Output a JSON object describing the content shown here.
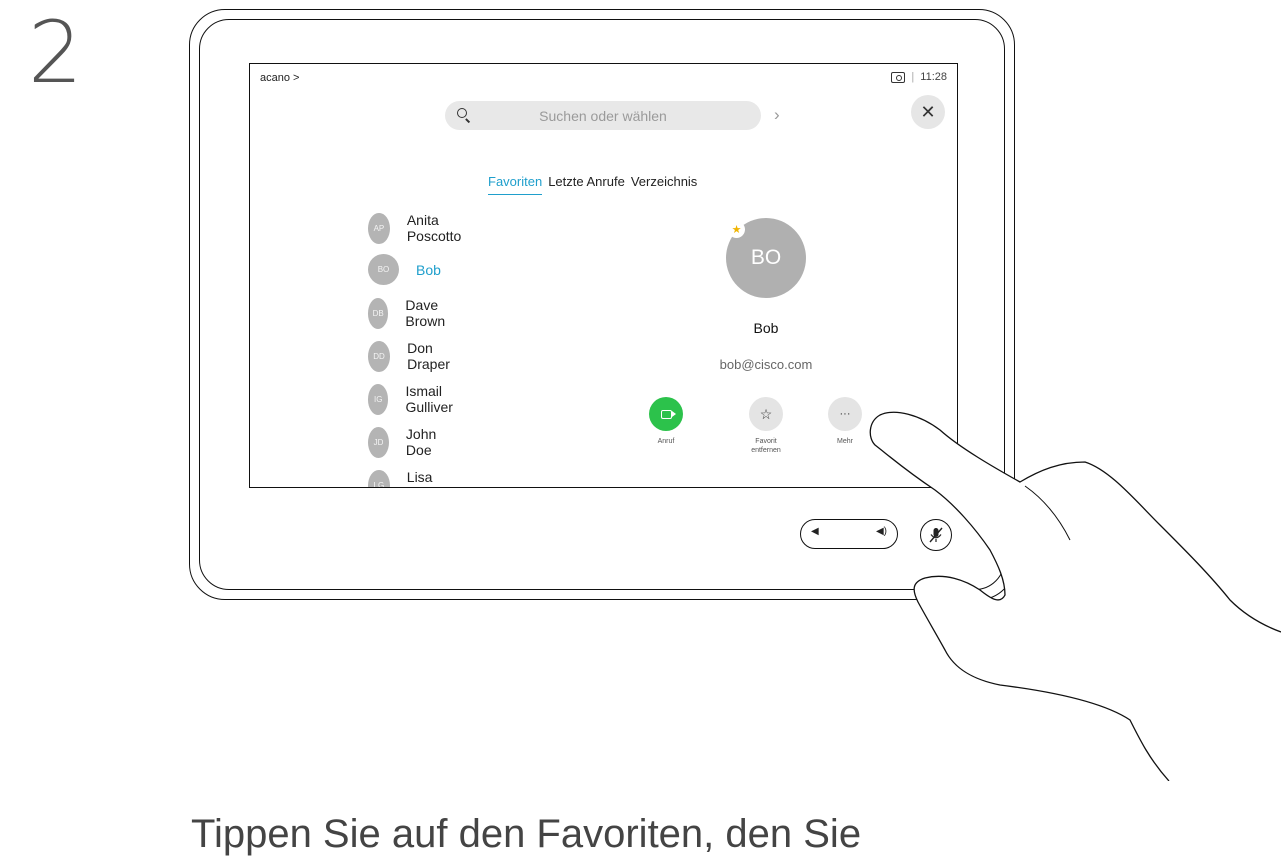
{
  "step_number": "2",
  "status_bar": {
    "brand": "acano",
    "time": "11:28"
  },
  "search": {
    "placeholder": "Suchen oder wählen"
  },
  "tabs": [
    {
      "label": "Favoriten",
      "active": true
    },
    {
      "label": "Letzte Anrufe",
      "active": false
    },
    {
      "label": "Verzeichnis",
      "active": false
    }
  ],
  "contacts": [
    {
      "initials": "AP",
      "name": "Anita Poscotto"
    },
    {
      "initials": "BO",
      "name": "Bob",
      "selected": true
    },
    {
      "initials": "DB",
      "name": "Dave Brown"
    },
    {
      "initials": "DD",
      "name": "Don Draper"
    },
    {
      "initials": "IG",
      "name": "Ismail Gulliver"
    },
    {
      "initials": "JD",
      "name": "John Doe"
    },
    {
      "initials": "LG",
      "name": "Lisa Green"
    }
  ],
  "detail": {
    "initials": "BO",
    "name": "Bob",
    "email": "bob@cisco.com",
    "actions": {
      "call": "Anruf",
      "favorite": "Favorit entfernen",
      "more": "Mehr"
    }
  },
  "caption": "Tippen Sie auf den Favoriten, den Sie"
}
